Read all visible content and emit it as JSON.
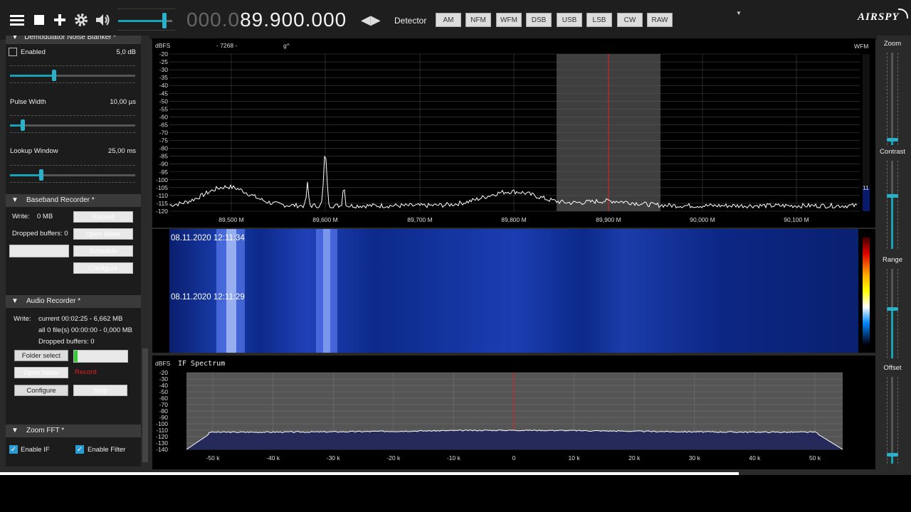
{
  "toolbar": {
    "icons": [
      "menu-icon",
      "stop-icon",
      "plus-icon",
      "gear-icon",
      "speaker-icon"
    ],
    "volume_level": 0.8,
    "freq_dim": "000.0",
    "freq_bright": "89.900.000",
    "arrows": "◀▶",
    "detector_label": "Detector",
    "modes": [
      "AM",
      "NFM",
      "WFM",
      "DSB",
      "USB",
      "LSB",
      "CW",
      "RAW"
    ],
    "dropdown_arrow": "▼",
    "logo": "AIRSPY"
  },
  "left": {
    "noise_blanker": {
      "title": "Demodulator Noise Blanker *",
      "enabled_label": "Enabled",
      "enabled_value": "5,0 dB",
      "level": 0.35,
      "pulse_width_label": "Pulse Width",
      "pulse_width_value": "10,00 µs",
      "pulse_width_level": 0.1,
      "lookup_window_label": "Lookup Window",
      "lookup_window_value": "25,00 ms",
      "lookup_window_level": 0.25
    },
    "baseband_recorder": {
      "title": "Baseband Recorder *",
      "write_label": "Write:",
      "write_value": "0 MB",
      "record_button": "Record",
      "dropped_label": "Dropped buffers: 0",
      "open_folder_button": "Open folder",
      "schedule_button": "Schedule",
      "configure_button": "Configure"
    },
    "audio_recorder": {
      "title": "Audio Recorder *",
      "write_label": "Write:",
      "write_current": "current 00:02:25 - 6,662 MB",
      "write_all": "all 0 file(s) 00:00:00 - 0,000 MB",
      "dropped": "Dropped buffers: 0",
      "folder_select_button": "Folder select",
      "open_folder_button": "Open folder",
      "record_label": "Record",
      "configure_button": "Configure",
      "stop_button": "Stop"
    },
    "zoom_fft": {
      "title": "Zoom FFT *",
      "enable_if": "Enable IF",
      "enable_filter": "Enable Filter"
    }
  },
  "main_spectrum": {
    "unit": "dBFS",
    "marker_text": "- 7268 -",
    "marker_text2": "g^",
    "mode_tag": "WFM",
    "side_value": "11",
    "y_ticks": [
      "-20",
      "-25",
      "-30",
      "-35",
      "-40",
      "-45",
      "-50",
      "-55",
      "-60",
      "-65",
      "-70",
      "-75",
      "-80",
      "-85",
      "-90",
      "-95",
      "-100",
      "-105",
      "-110",
      "-115",
      "-120"
    ],
    "x_ticks": [
      "89,500 M",
      "89,600 M",
      "89,700 M",
      "89,800 M",
      "89,900 M",
      "90,000 M",
      "90,100 M"
    ],
    "center_freq_label": "89,900 M"
  },
  "waterfall": {
    "timestamp1": "08.11.2020 12:11:34",
    "timestamp2": "08.11.2020 12:11:29"
  },
  "if_spectrum": {
    "unit": "dBFS",
    "title": "IF Spectrum",
    "y_ticks": [
      "-20",
      "-30",
      "-40",
      "-50",
      "-60",
      "-70",
      "-80",
      "-90",
      "-100",
      "-110",
      "-120",
      "-130",
      "-140"
    ],
    "x_ticks": [
      "-50 k",
      "-40 k",
      "-30 k",
      "-20 k",
      "-10 k",
      "0",
      "10 k",
      "20 k",
      "30 k",
      "40 k",
      "50 k"
    ]
  },
  "right_panel": {
    "zoom_label": "Zoom",
    "contrast_label": "Contrast",
    "range_label": "Range",
    "offset_label": "Offset",
    "zoom_level": 0.05,
    "contrast_level": 0.6,
    "range_level": 0.55,
    "offset_level": 0.1
  }
}
